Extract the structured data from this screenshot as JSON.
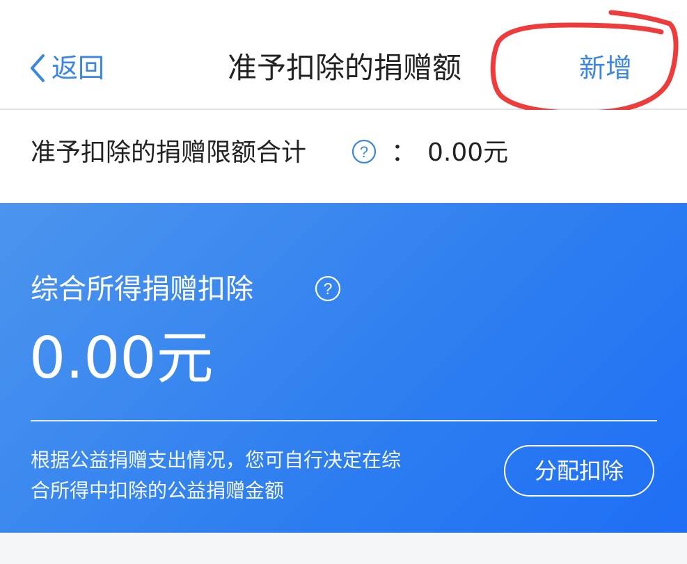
{
  "nav": {
    "back_label": "返回",
    "title": "准予扣除的捐赠额",
    "add_label": "新增"
  },
  "limit": {
    "label": "准予扣除的捐赠限额合计",
    "colon": "：",
    "value": "0.00元"
  },
  "card": {
    "title": "综合所得捐赠扣除",
    "amount": "0.00元",
    "desc_line1": "根据公益捐赠支出情况，您可自行决定在综",
    "desc_line2": "合所得中扣除的公益捐赠金额",
    "allocate_label": "分配扣除"
  },
  "colors": {
    "accent": "#3a86e0",
    "card_gradient_start": "#4c95ee",
    "card_gradient_end": "#1f6ef5",
    "annotation_red": "#ee3b3b"
  },
  "icons": {
    "back": "chevron-left-icon",
    "help": "question-circle-icon"
  }
}
